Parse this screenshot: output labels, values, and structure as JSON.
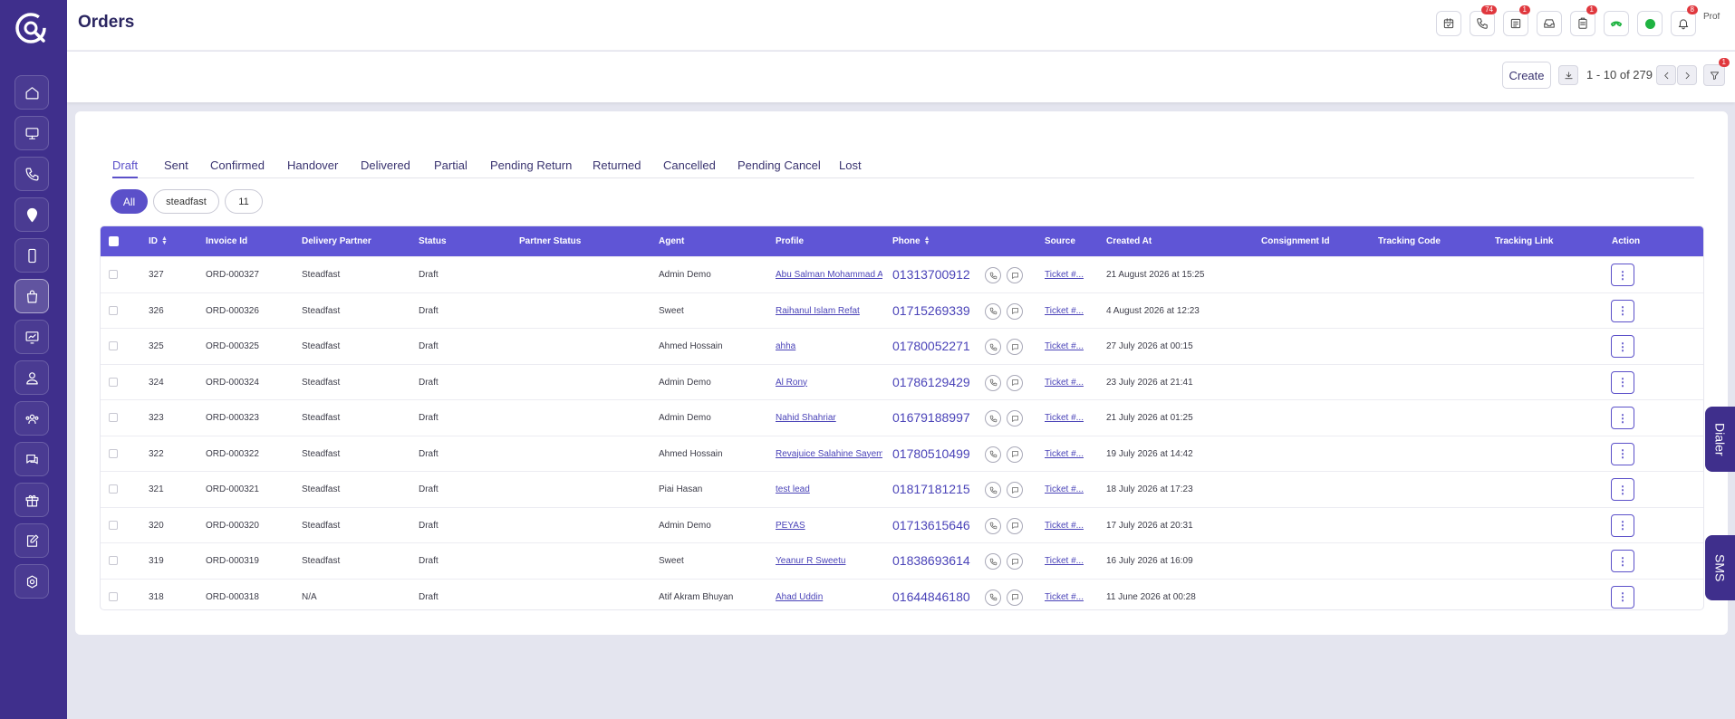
{
  "header": {
    "title": "Orders",
    "icons": [
      {
        "name": "calendar-icon",
        "badge": ""
      },
      {
        "name": "phone-icon",
        "badge": "74"
      },
      {
        "name": "tasks-icon",
        "badge": "1"
      },
      {
        "name": "inbox-icon",
        "badge": ""
      },
      {
        "name": "clipboard-icon",
        "badge": "1"
      },
      {
        "name": "call-green-icon",
        "badge": ""
      },
      {
        "name": "status-dot",
        "badge": ""
      },
      {
        "name": "bell-icon",
        "badge": "8"
      }
    ],
    "avatar_alt": "Prof"
  },
  "toolbar": {
    "create_label": "Create",
    "pagination": "1 - 10 of 279",
    "filter_badge": "1"
  },
  "tabs": [
    "Draft",
    "Sent",
    "Confirmed",
    "Handover",
    "Delivered",
    "Partial",
    "Pending Return",
    "Returned",
    "Cancelled",
    "Pending Cancel",
    "Lost"
  ],
  "chips": [
    "All",
    "steadfast",
    "11"
  ],
  "table": {
    "columns": [
      "ID",
      "Invoice Id",
      "Delivery Partner",
      "Status",
      "Partner Status",
      "Agent",
      "Profile",
      "Phone",
      "Source",
      "Created At",
      "Consignment Id",
      "Tracking Code",
      "Tracking Link",
      "Action"
    ],
    "rows": [
      {
        "id": "327",
        "invoice": "ORD-000327",
        "partner": "Steadfast",
        "status": "Draft",
        "partner_status": "",
        "agent": "Admin Demo",
        "profile": "Abu Salman Mohammad A",
        "phone": "01313700912",
        "source": "Ticket #...",
        "created": "21 August 2026 at 15:25",
        "consignment": "",
        "tracking_code": "",
        "tracking_link": ""
      },
      {
        "id": "326",
        "invoice": "ORD-000326",
        "partner": "Steadfast",
        "status": "Draft",
        "partner_status": "",
        "agent": "Sweet",
        "profile": "Raihanul Islam Refat",
        "phone": "01715269339",
        "source": "Ticket #...",
        "created": "4 August 2026 at 12:23",
        "consignment": "",
        "tracking_code": "",
        "tracking_link": ""
      },
      {
        "id": "325",
        "invoice": "ORD-000325",
        "partner": "Steadfast",
        "status": "Draft",
        "partner_status": "",
        "agent": "Ahmed Hossain",
        "profile": "ahha",
        "phone": "01780052271",
        "source": "Ticket #...",
        "created": "27 July 2026 at 00:15",
        "consignment": "",
        "tracking_code": "",
        "tracking_link": ""
      },
      {
        "id": "324",
        "invoice": "ORD-000324",
        "partner": "Steadfast",
        "status": "Draft",
        "partner_status": "",
        "agent": "Admin Demo",
        "profile": "Al Rony",
        "phone": "01786129429",
        "source": "Ticket #...",
        "created": "23 July 2026 at 21:41",
        "consignment": "",
        "tracking_code": "",
        "tracking_link": ""
      },
      {
        "id": "323",
        "invoice": "ORD-000323",
        "partner": "Steadfast",
        "status": "Draft",
        "partner_status": "",
        "agent": "Admin Demo",
        "profile": "Nahid Shahriar",
        "phone": "01679188997",
        "source": "Ticket #...",
        "created": "21 July 2026 at 01:25",
        "consignment": "",
        "tracking_code": "",
        "tracking_link": ""
      },
      {
        "id": "322",
        "invoice": "ORD-000322",
        "partner": "Steadfast",
        "status": "Draft",
        "partner_status": "",
        "agent": "Ahmed Hossain",
        "profile": "Revajuice Salahine Sayem",
        "phone": "01780510499",
        "source": "Ticket #...",
        "created": "19 July 2026 at 14:42",
        "consignment": "",
        "tracking_code": "",
        "tracking_link": ""
      },
      {
        "id": "321",
        "invoice": "ORD-000321",
        "partner": "Steadfast",
        "status": "Draft",
        "partner_status": "",
        "agent": "Piai Hasan",
        "profile": "test lead",
        "phone": "01817181215",
        "source": "Ticket #...",
        "created": "18 July 2026 at 17:23",
        "consignment": "",
        "tracking_code": "",
        "tracking_link": ""
      },
      {
        "id": "320",
        "invoice": "ORD-000320",
        "partner": "Steadfast",
        "status": "Draft",
        "partner_status": "",
        "agent": "Admin Demo",
        "profile": "PEYAS",
        "phone": "01713615646",
        "source": "Ticket #...",
        "created": "17 July 2026 at 20:31",
        "consignment": "",
        "tracking_code": "",
        "tracking_link": ""
      },
      {
        "id": "319",
        "invoice": "ORD-000319",
        "partner": "Steadfast",
        "status": "Draft",
        "partner_status": "",
        "agent": "Sweet",
        "profile": "Yeanur R Sweetu",
        "phone": "01838693614",
        "source": "Ticket #...",
        "created": "16 July 2026 at 16:09",
        "consignment": "",
        "tracking_code": "",
        "tracking_link": ""
      },
      {
        "id": "318",
        "invoice": "ORD-000318",
        "partner": "N/A",
        "status": "Draft",
        "partner_status": "",
        "agent": "Atif Akram Bhuyan",
        "profile": "Ahad Uddin",
        "phone": "01644846180",
        "source": "Ticket #...",
        "created": "11 June 2026 at 00:28",
        "consignment": "",
        "tracking_code": "",
        "tracking_link": ""
      }
    ]
  },
  "side_tabs": {
    "dialer": "Dialer",
    "sms": "SMS"
  },
  "colors": {
    "sidebar": "#3f2f8c",
    "accent": "#5b50c9",
    "table_header": "#5f55d6",
    "badge": "#e0383e",
    "online": "#1fb341"
  }
}
